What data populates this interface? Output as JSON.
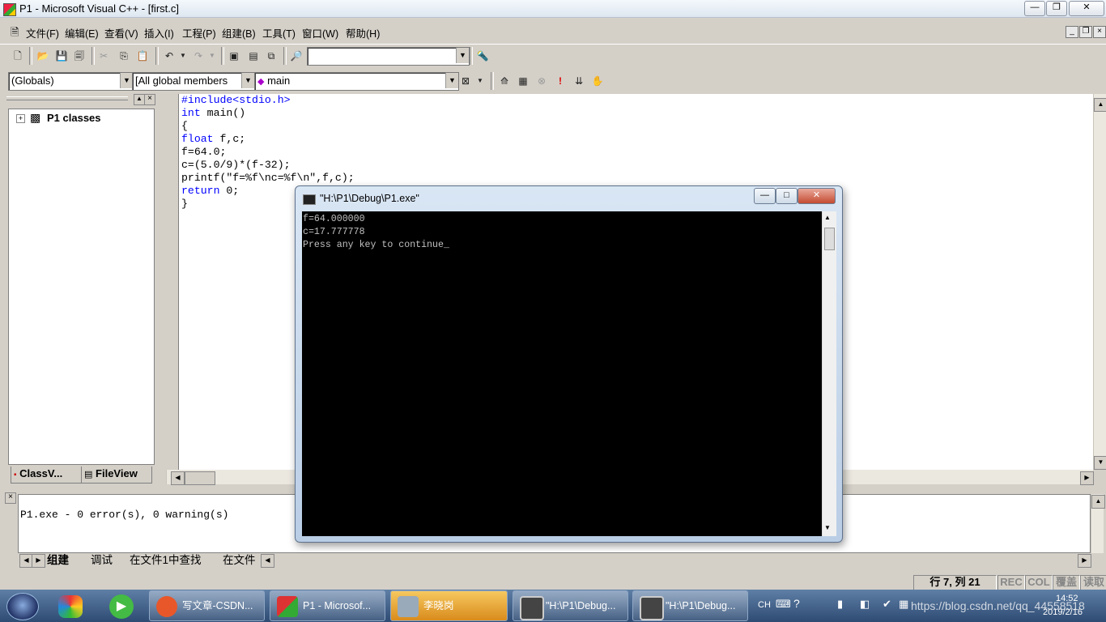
{
  "titlebar": {
    "title": "P1 - Microsoft Visual C++ - [first.c]",
    "min": "—",
    "max": "❐",
    "close": "✕"
  },
  "menu": [
    {
      "label": "文件(F)"
    },
    {
      "label": "编辑(E)"
    },
    {
      "label": "查看(V)"
    },
    {
      "label": "插入(I)"
    },
    {
      "label": "工程(P)"
    },
    {
      "label": "组建(B)"
    },
    {
      "label": "工具(T)"
    },
    {
      "label": "窗口(W)"
    },
    {
      "label": "帮助(H)"
    }
  ],
  "toolbar": {
    "find_combo_value": ""
  },
  "wizardbar": {
    "scope": "(Globals)",
    "members": "[All global members",
    "function": "main"
  },
  "classview": {
    "root": "P1 classes",
    "tabs": [
      "ClassV...",
      "FileView"
    ]
  },
  "editor": {
    "lines": [
      "#include<stdio.h>",
      "int main()",
      "{",
      "float f,c;",
      "f=64.0;",
      "c=(5.0/9)*(f-32);",
      "printf(\"f=%f\\nc=%f\\n\",f,c);",
      "return 0;",
      "}"
    ]
  },
  "console": {
    "title": "\"H:\\P1\\Debug\\P1.exe\"",
    "lines": [
      "f=64.000000",
      "c=17.777778",
      "Press any key to continue"
    ]
  },
  "output": {
    "text": "P1.exe - 0 error(s), 0 warning(s)",
    "tabs": [
      "组建",
      "调试",
      "在文件1中查找",
      "在文件"
    ]
  },
  "status": {
    "position": "行 7, 列 21",
    "rec": "REC",
    "col": "COL",
    "ovr": "覆盖",
    "read": "读取"
  },
  "taskbar": {
    "tasks": [
      {
        "label": "写文章-CSDN...",
        "color": "#e8572a"
      },
      {
        "label": "P1 - Microsof...",
        "color": "#d33"
      },
      {
        "label": "李晓岗",
        "color": "#9ab"
      },
      {
        "label": "\"H:\\P1\\Debug...",
        "color": "#444"
      },
      {
        "label": "\"H:\\P1\\Debug...",
        "color": "#444"
      }
    ],
    "ime": "CH",
    "clock_time": "14:52",
    "clock_date": "2019/2/16",
    "watermark": "https://blog.csdn.net/qq_44558518"
  }
}
